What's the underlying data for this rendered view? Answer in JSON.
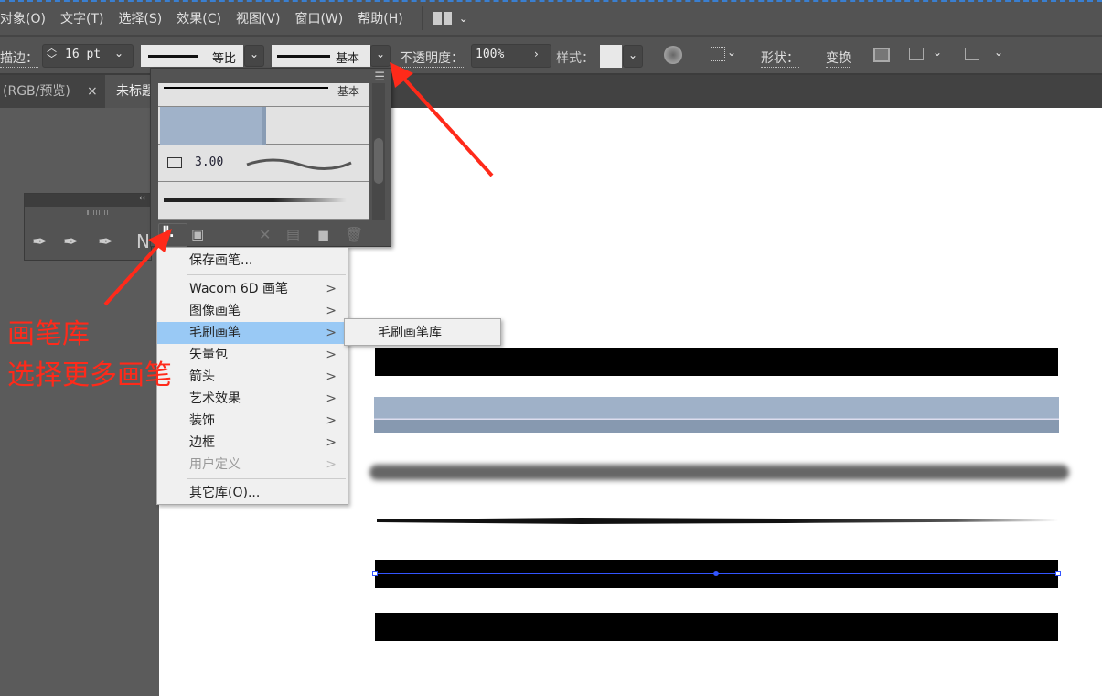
{
  "menubar": {
    "items": [
      "对象(O)",
      "文字(T)",
      "选择(S)",
      "效果(C)",
      "视图(V)",
      "窗口(W)",
      "帮助(H)"
    ]
  },
  "control": {
    "stroke_label": "描边：",
    "stroke_value": "16 pt",
    "profile_label": "等比",
    "brush_label": "基本",
    "opacity_label": "不透明度：",
    "opacity_value": "100%",
    "style_label": "样式：",
    "shape_label": "形状：",
    "transform_label": "变换"
  },
  "tabs": [
    {
      "label": "(RGB/预览)",
      "close": "×"
    },
    {
      "label": "未标题"
    }
  ],
  "brush_panel": {
    "rows": [
      {
        "label": "基本"
      },
      {
        "label": ""
      },
      {
        "label": "3.00"
      },
      {
        "label": ""
      }
    ]
  },
  "context_menu": {
    "items": [
      {
        "label": "保存画笔..."
      },
      {
        "label": "Wacom 6D 画笔",
        "submenu": true
      },
      {
        "label": "图像画笔",
        "submenu": true
      },
      {
        "label": "毛刷画笔",
        "submenu": true,
        "highlighted": true
      },
      {
        "label": "矢量包",
        "submenu": true
      },
      {
        "label": "箭头",
        "submenu": true
      },
      {
        "label": "艺术效果",
        "submenu": true
      },
      {
        "label": "装饰",
        "submenu": true
      },
      {
        "label": "边框",
        "submenu": true
      },
      {
        "label": "用户定义",
        "submenu": true,
        "disabled": true
      },
      {
        "label": "其它库(O)..."
      }
    ],
    "arrow": ">"
  },
  "submenu": {
    "items": [
      "毛刷画笔库"
    ]
  },
  "annotation": {
    "line1": "画笔库",
    "line2": "选择更多画笔",
    "color": "#ff2a1a"
  },
  "colors": {
    "highlight": "#99c9f5",
    "selection": "#3355ff"
  }
}
